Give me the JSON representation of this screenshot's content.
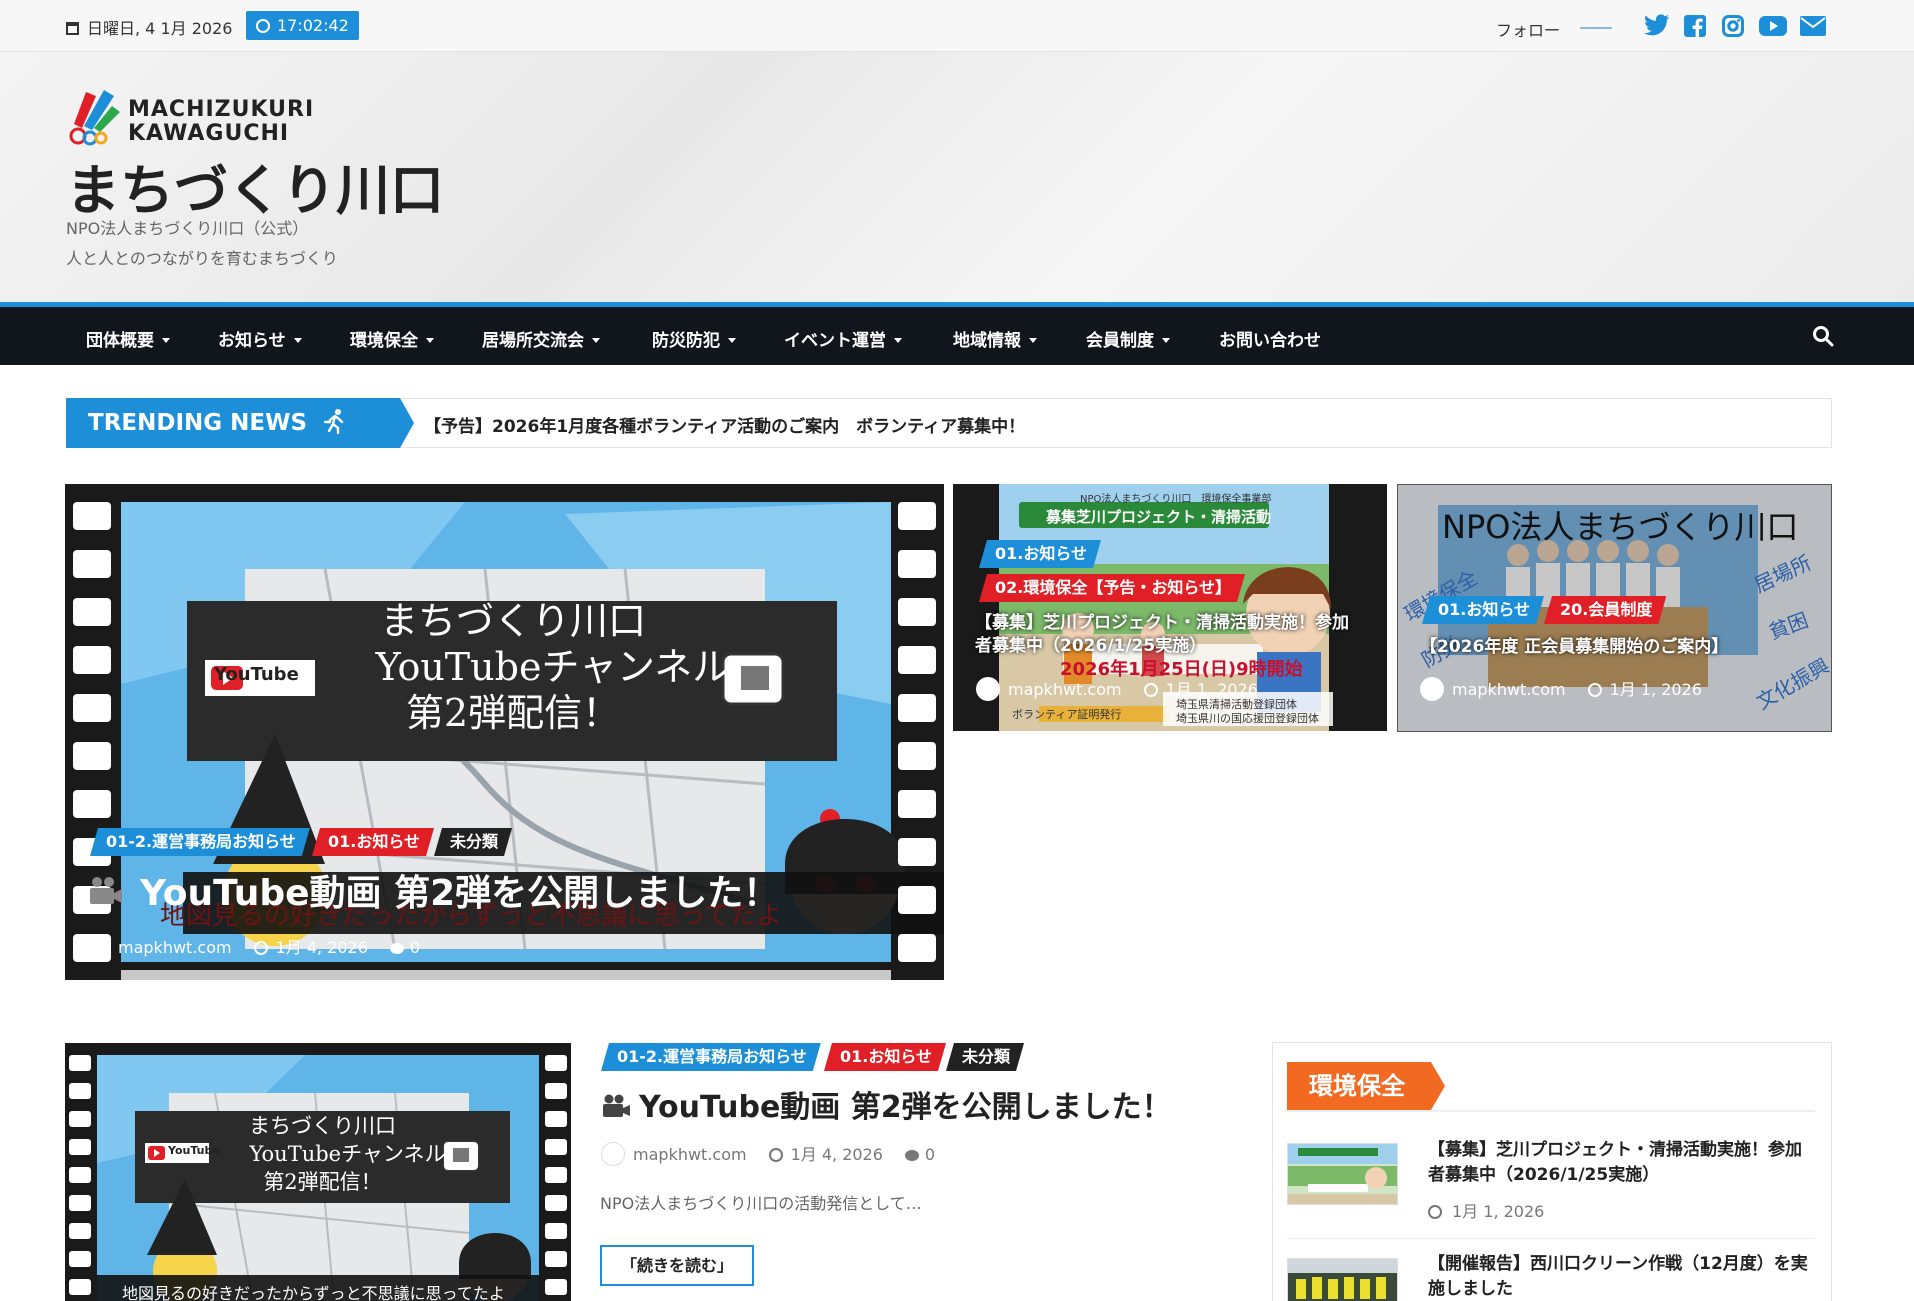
{
  "topbar": {
    "date": "日曜日, 4 1月 2026",
    "time": "17:02:42",
    "follow_label": "フォロー"
  },
  "social_icons": [
    "twitter-icon",
    "facebook-icon",
    "instagram-icon",
    "youtube-icon",
    "mail-icon"
  ],
  "header": {
    "logo_line1": "MACHIZUKURI",
    "logo_line2": "KAWAGUCHI",
    "site_title": "まちづくり川口",
    "desc_line1": "NPO法人まちづくり川口（公式）",
    "desc_line2": "人と人とのつながりを育むまちづくり"
  },
  "nav": {
    "items": [
      {
        "label": "団体概要",
        "dropdown": true
      },
      {
        "label": "お知らせ",
        "dropdown": true
      },
      {
        "label": "環境保全",
        "dropdown": true
      },
      {
        "label": "居場所交流会",
        "dropdown": true
      },
      {
        "label": "防災防犯",
        "dropdown": true
      },
      {
        "label": "イベント運営",
        "dropdown": true
      },
      {
        "label": "地域情報",
        "dropdown": true
      },
      {
        "label": "会員制度",
        "dropdown": true
      },
      {
        "label": "お問い合わせ",
        "dropdown": false
      }
    ]
  },
  "trending": {
    "label": "TRENDING NEWS",
    "headline": "【予告】2026年1月度各種ボランティア活動のご案内　ボランティア募集中！"
  },
  "hero": {
    "image_line1": "まちづくり川口",
    "image_youtube": "YouTube",
    "image_line2": "YouTubeチャンネル",
    "image_line3": "第2弾配信！",
    "image_subtitle": "地図見るの好きだったからずっと不思議に思ってたよ",
    "tags": [
      "01-2.運営事務局お知らせ",
      "01.お知らせ",
      "未分類"
    ],
    "title": "YouTube動画 第2弾を公開しました！",
    "author": "mapkhwt.com",
    "date": "1月 4, 2026",
    "comments": "0"
  },
  "card1": {
    "image_header": "NPO法人まちづくり川口　環境保全事業部",
    "image_banner": "募集芝川プロジェクト・清掃活動",
    "image_date": "2026年1月25日(日)9時開始",
    "image_note": "ボランティア証明発行",
    "image_org1": "埼玉県清掃活動登録団体",
    "image_org2": "埼玉県川の国応援団登録団体",
    "tags": [
      "01.お知らせ",
      "02.環境保全【予告・お知らせ】"
    ],
    "title": "【募集】芝川プロジェクト・清掃活動実施！参加者募集中（2026/1/25実施）",
    "author": "mapkhwt.com",
    "date": "1月 1, 2026"
  },
  "card2": {
    "image_heading": "NPO法人まちづくり川口",
    "image_words": [
      "居場所",
      "環境保全",
      "貧困",
      "文化振興",
      "防災"
    ],
    "tags": [
      "01.お知らせ",
      "20.会員制度"
    ],
    "title": "【2026年度 正会員募集開始のご案内】",
    "author": "mapkhwt.com",
    "date": "1月 1, 2026"
  },
  "post": {
    "image_line1": "まちづくり川口",
    "image_youtube": "YouTube",
    "image_line2": "YouTubeチャンネル",
    "image_line3": "第2弾配信！",
    "image_subtitle": "地図見るの好きだったからずっと不思議に思ってたよ",
    "tags": [
      "01-2.運営事務局お知らせ",
      "01.お知らせ",
      "未分類"
    ],
    "title": "YouTube動画 第2弾を公開しました！",
    "author": "mapkhwt.com",
    "date": "1月 4, 2026",
    "comments": "0",
    "excerpt": "NPO法人まちづくり川口の活動発信として…",
    "read_more": "「続きを読む」"
  },
  "sidebar": {
    "heading": "環境保全",
    "items": [
      {
        "title": "【募集】芝川プロジェクト・清掃活動実施！参加者募集中（2026/1/25実施）",
        "date": "1月 1, 2026"
      },
      {
        "title": "【開催報告】西川口クリーン作戦（12月度）を実施しました",
        "date": ""
      }
    ]
  },
  "colors": {
    "accent": "#1c8fd8",
    "nav_bg": "#11161d",
    "red_tag": "#e01f26",
    "orange": "#f26a21"
  }
}
